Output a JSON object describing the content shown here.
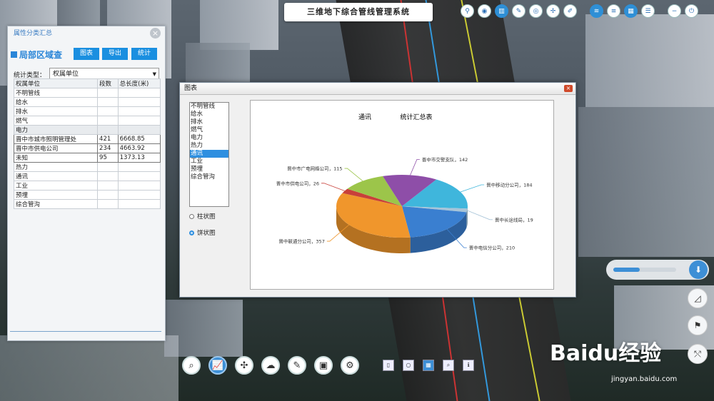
{
  "app_title": "三维地下综合管线管理系统",
  "top_toolbar": [
    "pin-icon",
    "marker-icon",
    "chart-icon",
    "compass-icon",
    "target-icon",
    "measure-icon",
    "edit-icon",
    "layers-icon",
    "list-icon",
    "grid-icon",
    "menu-icon",
    "minimize-icon",
    "close-icon"
  ],
  "panel": {
    "title": "属性分类汇总",
    "heading": "局部区域查",
    "btn_chart": "图表",
    "btn_export": "导出",
    "btn_stats": "统计",
    "stat_type_label": "统计类型：",
    "stat_type_value": "权属单位",
    "columns": [
      "权属单位",
      "段数",
      "总长度(米)"
    ],
    "rows": [
      {
        "name": "不明管线",
        "count": "",
        "length": "",
        "kind": "row"
      },
      {
        "name": "给水",
        "count": "",
        "length": "",
        "kind": "row"
      },
      {
        "name": "排水",
        "count": "",
        "length": "",
        "kind": "row"
      },
      {
        "name": "燃气",
        "count": "",
        "length": "",
        "kind": "row"
      },
      {
        "name": "电力",
        "count": "",
        "length": "",
        "kind": "grp"
      },
      {
        "name": "晋中市城市照明管理处",
        "count": "421",
        "length": "6668.85",
        "kind": "sub"
      },
      {
        "name": "晋中市供电公司",
        "count": "234",
        "length": "4663.92",
        "kind": "sub"
      },
      {
        "name": "未知",
        "count": "95",
        "length": "1373.13",
        "kind": "sub"
      },
      {
        "name": "热力",
        "count": "",
        "length": "",
        "kind": "row"
      },
      {
        "name": "通讯",
        "count": "",
        "length": "",
        "kind": "row"
      },
      {
        "name": "工业",
        "count": "",
        "length": "",
        "kind": "row"
      },
      {
        "name": "预埋",
        "count": "",
        "length": "",
        "kind": "row"
      },
      {
        "name": "综合管沟",
        "count": "",
        "length": "",
        "kind": "row"
      }
    ]
  },
  "dialog": {
    "title": "图表",
    "close": "×",
    "list": [
      "不明管线",
      "给水",
      "排水",
      "燃气",
      "电力",
      "热力",
      "通讯",
      "工业",
      "预埋",
      "综合管沟"
    ],
    "selected_index": 6,
    "radio_bar": "柱状图",
    "radio_pie": "饼状图",
    "selected_chart": "pie"
  },
  "chart_data": {
    "type": "pie",
    "title": "通讯",
    "subtitle": "统计汇总表",
    "slices": [
      {
        "label": "晋中移动分公司",
        "value": 184,
        "color": "#3fb6dc"
      },
      {
        "label": "晋中长途线局",
        "value": 19,
        "color": "#a7c4d8"
      },
      {
        "label": "晋中电信分公司",
        "value": 210,
        "color": "#3a7fd0"
      },
      {
        "label": "晋中联通分公司",
        "value": 357,
        "color": "#f0962c"
      },
      {
        "label": "晋中市供电公司",
        "value": 26,
        "color": "#c8403a"
      },
      {
        "label": "晋中市广电网络公司",
        "value": 115,
        "color": "#9cc54a"
      },
      {
        "label": "晋中市交警支队",
        "value": 142,
        "color": "#8e4ea8"
      }
    ]
  },
  "zoom": {
    "level": 0.42
  },
  "right_buttons": [
    "measure-icon",
    "flag-icon",
    "route-icon"
  ],
  "watermark": {
    "logo": "Baidu经验",
    "url": "jingyan.baidu.com"
  }
}
